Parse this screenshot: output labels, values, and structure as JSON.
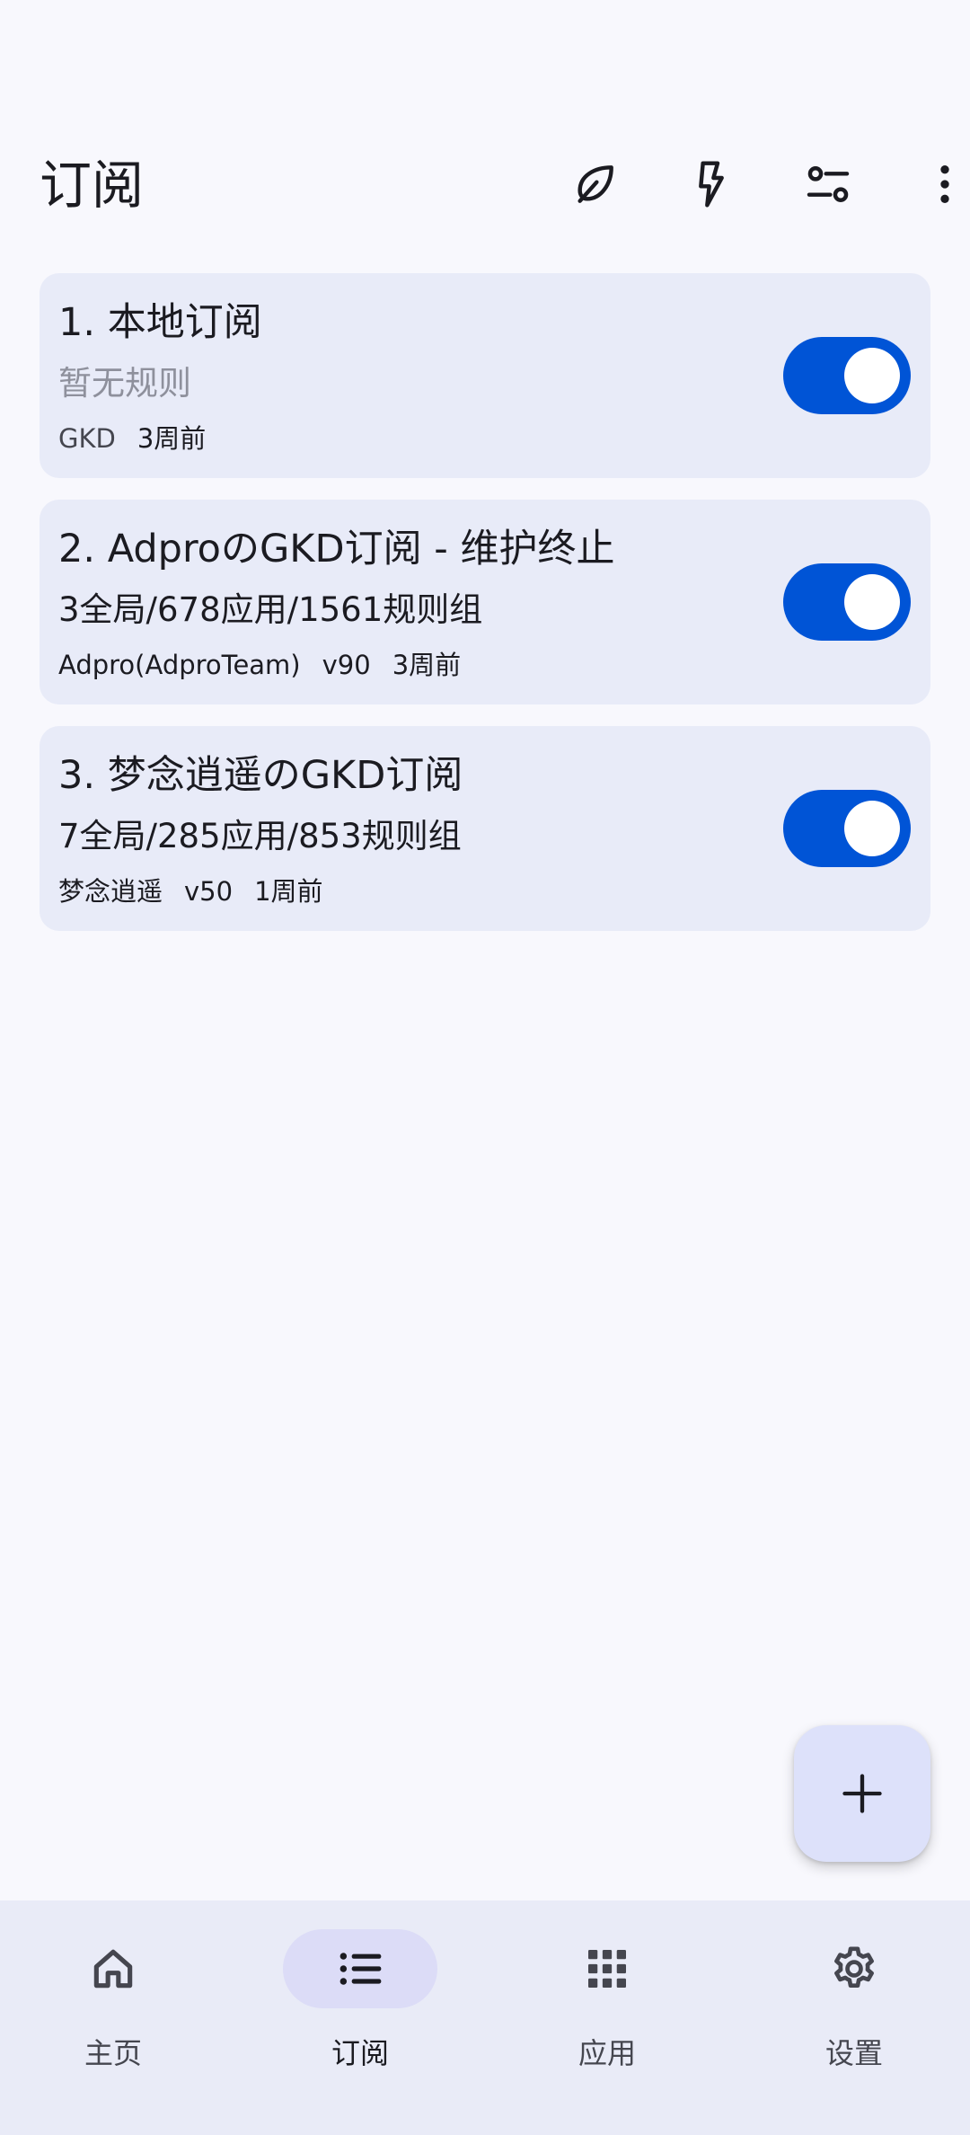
{
  "header": {
    "title": "订阅",
    "actions": [
      {
        "icon": "leaf-icon"
      },
      {
        "icon": "flash-icon"
      },
      {
        "icon": "filter-icon"
      },
      {
        "icon": "more-vert-icon"
      }
    ]
  },
  "subscriptions": [
    {
      "title": "1. 本地订阅",
      "desc": "暂无规则",
      "meta": [
        "GKD",
        "3周前"
      ],
      "enabled": true
    },
    {
      "title": "2. AdproのGKD订阅 - 维护终止",
      "desc": "3全局/678应用/1561规则组",
      "meta": [
        "Adpro(AdproTeam)",
        "v90",
        "3周前"
      ],
      "enabled": true
    },
    {
      "title": "3. 梦念逍遥のGKD订阅",
      "desc": "7全局/285应用/853规则组",
      "meta": [
        "梦念逍遥",
        "v50",
        "1周前"
      ],
      "enabled": true
    }
  ],
  "fab": {
    "icon": "add-icon"
  },
  "nav": {
    "items": [
      {
        "label": "主页",
        "icon": "home-icon"
      },
      {
        "label": "订阅",
        "icon": "list-icon",
        "active": true
      },
      {
        "label": "应用",
        "icon": "apps-grid-icon"
      },
      {
        "label": "设置",
        "icon": "settings-gear-icon"
      }
    ]
  },
  "colors": {
    "background": "#f8f8fd",
    "card": "#e8ebf8",
    "toggle_on": "#0054d6",
    "fab": "#dde1fa",
    "nav_bg": "#e9ebf7",
    "nav_active_pill": "#dcdcf7"
  }
}
